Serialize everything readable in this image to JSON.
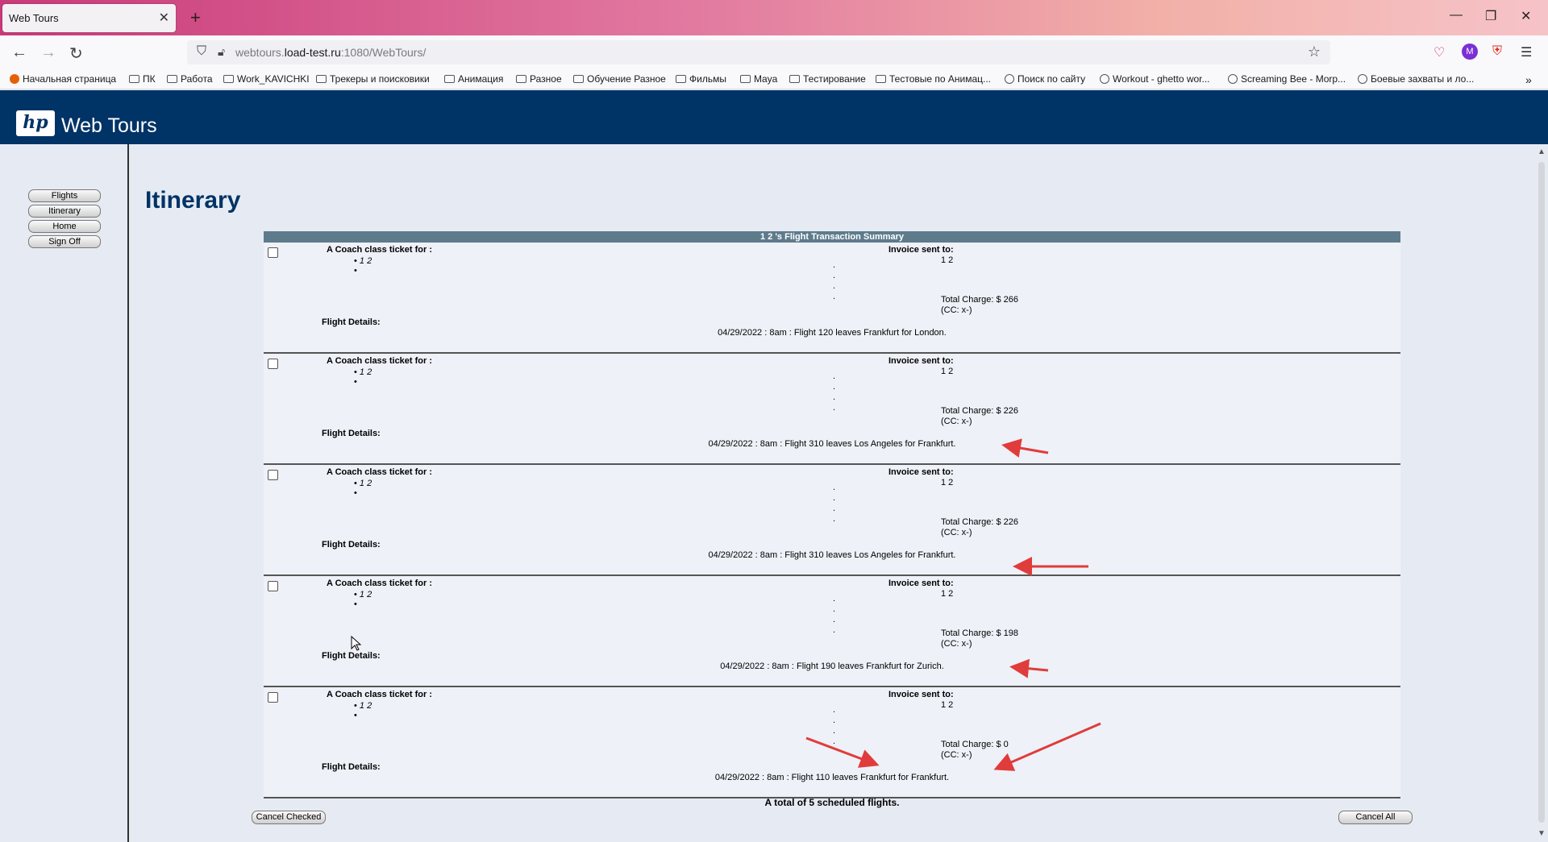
{
  "browser": {
    "tab_title": "Web Tours",
    "url_host_prefix": "webtours.",
    "url_host_main": "load-test.ru",
    "url_rest": ":1080/WebTours/",
    "avatar_letter": "M"
  },
  "bookmarks": [
    {
      "label": "Начальная страница",
      "icon": "firefox-icon"
    },
    {
      "label": "ПК",
      "icon": "folder-icon"
    },
    {
      "label": "Работа",
      "icon": "folder-icon"
    },
    {
      "label": "Work_KAVICHKI",
      "icon": "folder-icon"
    },
    {
      "label": "Трекеры и поисковики",
      "icon": "folder-icon"
    },
    {
      "label": "Анимация",
      "icon": "folder-icon"
    },
    {
      "label": "Разное",
      "icon": "folder-icon"
    },
    {
      "label": "Обучение Разное",
      "icon": "folder-icon"
    },
    {
      "label": "Фильмы",
      "icon": "folder-icon"
    },
    {
      "label": "Maya",
      "icon": "folder-icon"
    },
    {
      "label": "Тестирование",
      "icon": "folder-icon"
    },
    {
      "label": "Тестовые по Анимац...",
      "icon": "folder-icon"
    },
    {
      "label": "Поиск по сайту",
      "icon": "globe-icon"
    },
    {
      "label": "Workout - ghetto wor...",
      "icon": "globe-icon"
    },
    {
      "label": "Screaming Bee - Morp...",
      "icon": "globe-icon"
    },
    {
      "label": "Боевые захваты и ло...",
      "icon": "globe-icon"
    }
  ],
  "site": {
    "logo_text": "hp",
    "title": "Web Tours"
  },
  "leftnav": [
    "Flights",
    "Itinerary",
    "Home",
    "Sign Off"
  ],
  "page_title": "Itinerary",
  "summary_header": "1 2 's Flight Transaction Summary",
  "labels": {
    "ticket_for": "A Coach class ticket for :",
    "invoice_sent": "Invoice sent to:",
    "flight_details": "Flight Details:",
    "cc": "(CC: x-)"
  },
  "flights": [
    {
      "passenger": "1 2",
      "invoice_name": "1 2",
      "total_charge": "Total Charge: $ 266",
      "details": "04/29/2022 : 8am : Flight 120 leaves Frankfurt for London."
    },
    {
      "passenger": "1 2",
      "invoice_name": "1 2",
      "total_charge": "Total Charge: $ 226",
      "details": "04/29/2022 : 8am : Flight 310 leaves Los Angeles for Frankfurt."
    },
    {
      "passenger": "1 2",
      "invoice_name": "1 2",
      "total_charge": "Total Charge: $ 226",
      "details": "04/29/2022 : 8am : Flight 310 leaves Los Angeles for Frankfurt."
    },
    {
      "passenger": "1 2",
      "invoice_name": "1 2",
      "total_charge": "Total Charge: $ 198",
      "details": "04/29/2022 : 8am : Flight 190 leaves Frankfurt for Zurich."
    },
    {
      "passenger": "1 2",
      "invoice_name": "1 2",
      "total_charge": "Total Charge: $ 0",
      "details": "04/29/2022 : 8am : Flight 110 leaves Frankfurt for Frankfurt."
    }
  ],
  "total_text": "A total of 5 scheduled flights.",
  "buttons": {
    "cancel_checked": "Cancel Checked",
    "cancel_all": "Cancel All"
  },
  "colors": {
    "header_bg": "#003366",
    "table_header": "#5e7b8c",
    "annotation_arrow": "#e03c3c"
  }
}
